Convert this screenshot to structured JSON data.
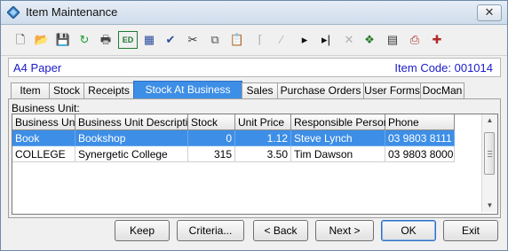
{
  "window": {
    "title": "Item Maintenance",
    "close_glyph": "✕"
  },
  "toolbar": {
    "icons": [
      {
        "name": "new-icon",
        "glyph": "🗋",
        "color": "#333333"
      },
      {
        "name": "open-icon",
        "glyph": "📂",
        "color": "#c99a20"
      },
      {
        "name": "save-icon",
        "glyph": "💾",
        "color": "#9a9a9a"
      },
      {
        "name": "refresh-icon",
        "glyph": "↻",
        "color": "#1f9a2f"
      },
      {
        "name": "print-icon",
        "glyph": "🖶",
        "color": "#444444"
      },
      {
        "name": "edit-icon",
        "glyph": "ED",
        "color": "#1f7a2f"
      },
      {
        "name": "calculator-icon",
        "glyph": "▦",
        "color": "#2a4e9a"
      },
      {
        "name": "spellcheck-icon",
        "glyph": "✔",
        "color": "#2a4e9a"
      },
      {
        "name": "cut-icon",
        "glyph": "✂",
        "color": "#333333"
      },
      {
        "name": "copy-icon",
        "glyph": "⧉",
        "color": "#555555"
      },
      {
        "name": "paste-icon",
        "glyph": "📋",
        "color": "#a07a2a"
      },
      {
        "name": "first-record-icon",
        "glyph": "⌈",
        "color": "#b0b0b0"
      },
      {
        "name": "previous-record-icon",
        "glyph": "⁄",
        "color": "#b0b0b0"
      },
      {
        "name": "next-record-icon",
        "glyph": "▸",
        "color": "#111111"
      },
      {
        "name": "last-record-icon",
        "glyph": "▸|",
        "color": "#111111"
      },
      {
        "name": "delete-icon",
        "glyph": "✕",
        "color": "#b0b0b0"
      },
      {
        "name": "grid-settings-icon",
        "glyph": "❖",
        "color": "#2a7a2a"
      },
      {
        "name": "media-icon",
        "glyph": "▤",
        "color": "#333333"
      },
      {
        "name": "print-labels-icon",
        "glyph": "⎙",
        "color": "#b02a2a"
      },
      {
        "name": "add-task-icon",
        "glyph": "✚",
        "color": "#b02a2a"
      }
    ]
  },
  "header": {
    "item_name": "A4 Paper",
    "item_code": "Item Code: 001014"
  },
  "tabs": [
    "Item",
    "Stock",
    "Receipts",
    "Stock At Business Units",
    "Sales",
    "Purchase Orders",
    "User Forms",
    "DocMan"
  ],
  "active_tab": "Stock At Business Units",
  "panel": {
    "business_unit_label": "Business Unit:"
  },
  "grid": {
    "columns": [
      "Business Unit",
      "Business Unit Description",
      "Stock",
      "Unit Price",
      "Responsible Person",
      "Phone"
    ],
    "rows": [
      {
        "unit": "Book",
        "description": "Bookshop",
        "stock": "0",
        "price": "1.12",
        "person": "Steve Lynch",
        "phone": "03 9803 8111",
        "selected": true
      },
      {
        "unit": "COLLEGE",
        "description": "Synergetic College",
        "stock": "315",
        "price": "3.50",
        "person": "Tim Dawson",
        "phone": "03 9803 8000",
        "selected": false
      }
    ]
  },
  "buttons": {
    "keep": "Keep",
    "criteria": "Criteria...",
    "back": "< Back",
    "next": "Next >",
    "ok": "OK",
    "exit": "Exit"
  },
  "colors": {
    "accent": "#3d8ee6",
    "header_text": "#1a1ac8"
  }
}
